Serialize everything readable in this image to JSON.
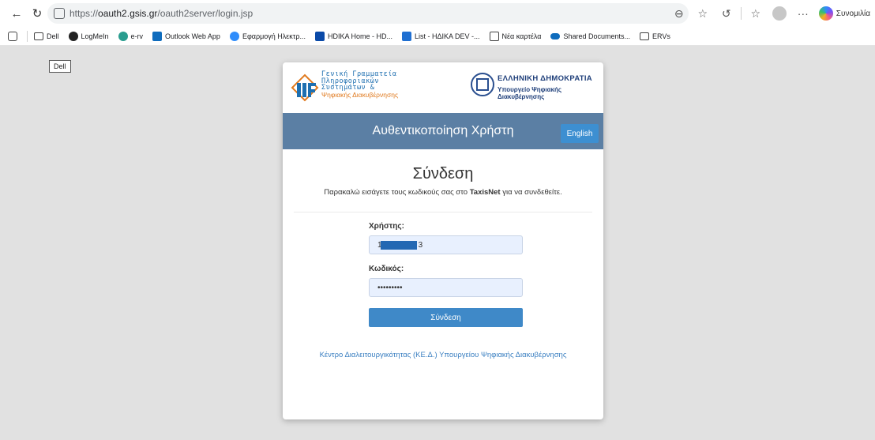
{
  "browser": {
    "url_scheme": "https://",
    "url_domain": "oauth2.gsis.gr",
    "url_path": "/oauth2server/login.jsp",
    "copilot_label": "Συνομιλία"
  },
  "bookmarks": [
    {
      "label": "Dell",
      "icon": "folder-icon"
    },
    {
      "label": "LogMeIn",
      "icon": "logmein-icon",
      "color": "#222222"
    },
    {
      "label": "e-rv",
      "icon": "edge-icon",
      "color": "#2a9d8f"
    },
    {
      "label": "Outlook Web App",
      "icon": "outlook-icon",
      "color": "#0f6cbd"
    },
    {
      "label": "Εφαρμογή Ηλεκτρ...",
      "icon": "edge-icon",
      "color": "#2f8dfb"
    },
    {
      "label": "HDIKA Home - HD...",
      "icon": "app-icon",
      "color": "#0a4aa8"
    },
    {
      "label": "List - HΔΙΚΑ DEV -...",
      "icon": "app-icon",
      "color": "#1f6fd1"
    },
    {
      "label": "Νέα καρτέλα",
      "icon": "tab-icon"
    },
    {
      "label": "Shared Documents...",
      "icon": "cloud-icon",
      "color": "#0f6cbd"
    },
    {
      "label": "ERVs",
      "icon": "folder-icon"
    }
  ],
  "tooltip": "Dell",
  "login": {
    "org_logo_lines": [
      "Γενική Γραμματεία",
      "Πληροφοριακών",
      "Συστημάτων &"
    ],
    "org_logo_sub": "Ψηφιακής Διακυβέρνησης",
    "gov_title": "ΕΛΛΗΝΙΚΗ ΔΗΜΟΚΡΑΤΙΑ",
    "gov_sub_1": "Υπουργείο Ψηφιακής",
    "gov_sub_2": "Διακυβέρνησης",
    "header_title": "Αυθεντικοποίηση Χρήστη",
    "lang_button": "English",
    "form_title": "Σύνδεση",
    "desc_before": "Παρακαλώ εισάγετε τους κωδικούς σας στο ",
    "desc_bold": "TaxisNet",
    "desc_after": " για να συνδεθείτε.",
    "username_label": "Χρήστης:",
    "username_prefix": "1",
    "username_suffix": "3",
    "password_label": "Κωδικός:",
    "password_value": "•••••••••",
    "submit": "Σύνδεση",
    "footer_link": "Κέντρο Διαλειτουργικότητας (ΚΕ.Δ.) Υπουργείου Ψηφιακής Διακυβέρνησης"
  }
}
